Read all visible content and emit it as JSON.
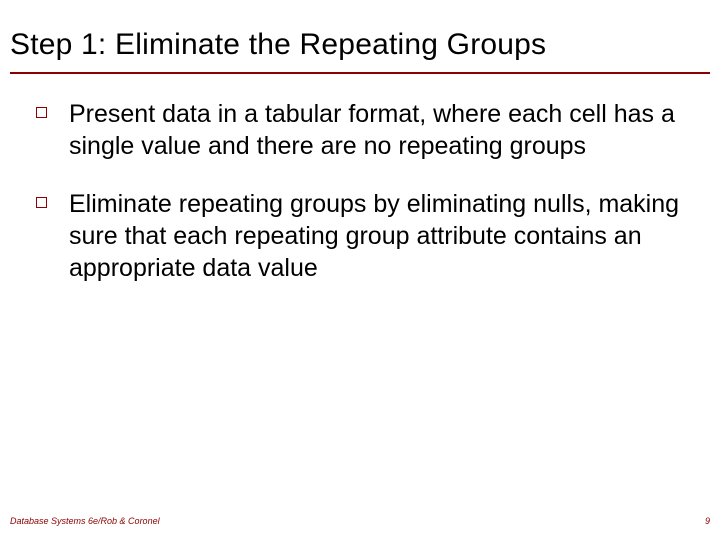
{
  "title": "Step 1: Eliminate the Repeating Groups",
  "bullets": [
    "Present data in a tabular format, where each cell has a single value and there are no repeating groups",
    "Eliminate repeating groups by eliminating nulls, making sure that each repeating group attribute contains an appropriate data value"
  ],
  "footer": {
    "source": "Database Systems 6e/Rob & Coronel",
    "page": "9"
  },
  "colors": {
    "accent": "#8b0000"
  }
}
